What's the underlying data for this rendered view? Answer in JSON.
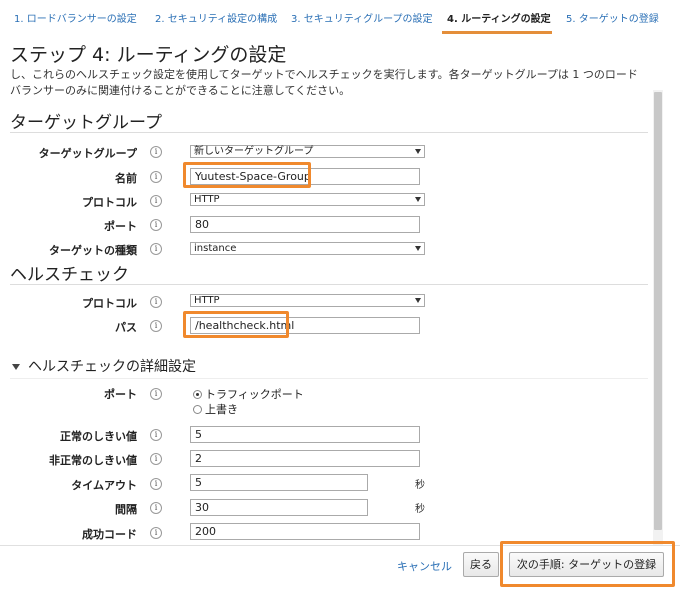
{
  "steps": [
    {
      "label": "1. ロードバランサーの設定",
      "active": false
    },
    {
      "label": "2. セキュリティ設定の構成",
      "active": false
    },
    {
      "label": "3. セキュリティグループの設定",
      "active": false
    },
    {
      "label": "4. ルーティングの設定",
      "active": true
    },
    {
      "label": "5. ターゲットの登録",
      "active": false
    }
  ],
  "page": {
    "title": "ステップ 4: ルーティングの設定",
    "description": "し、これらのヘルスチェック設定を使用してターゲットでヘルスチェックを実行します。各ターゲットグループは 1 つのロードバランサーのみに関連付けることができることに注意してください。"
  },
  "target_group": {
    "section_title": "ターゲットグループ",
    "target_group_label": "ターゲットグループ",
    "target_group_value": "新しいターゲットグループ",
    "name_label": "名前",
    "name_value": "Yuutest-Space-Group",
    "protocol_label": "プロトコル",
    "protocol_value": "HTTP",
    "port_label": "ポート",
    "port_value": "80",
    "target_type_label": "ターゲットの種類",
    "target_type_value": "instance"
  },
  "health_check": {
    "section_title": "ヘルスチェック",
    "protocol_label": "プロトコル",
    "protocol_value": "HTTP",
    "path_label": "パス",
    "path_value": "/healthcheck.html"
  },
  "advanced": {
    "title": "ヘルスチェックの詳細設定",
    "port_label": "ポート",
    "port_option_traffic": "トラフィックポート",
    "port_option_override": "上書き",
    "port_selected": "トラフィックポート",
    "healthy_label": "正常のしきい値",
    "healthy_value": "5",
    "unhealthy_label": "非正常のしきい値",
    "unhealthy_value": "2",
    "timeout_label": "タイムアウト",
    "timeout_value": "5",
    "timeout_unit": "秒",
    "interval_label": "間隔",
    "interval_value": "30",
    "interval_unit": "秒",
    "success_label": "成功コード",
    "success_value": "200"
  },
  "footer": {
    "cancel": "キャンセル",
    "back": "戻る",
    "next": "次の手順: ターゲットの登録"
  },
  "info_glyph": "i",
  "colors": {
    "accent": "#f0892d",
    "link": "#2a6fb5"
  }
}
